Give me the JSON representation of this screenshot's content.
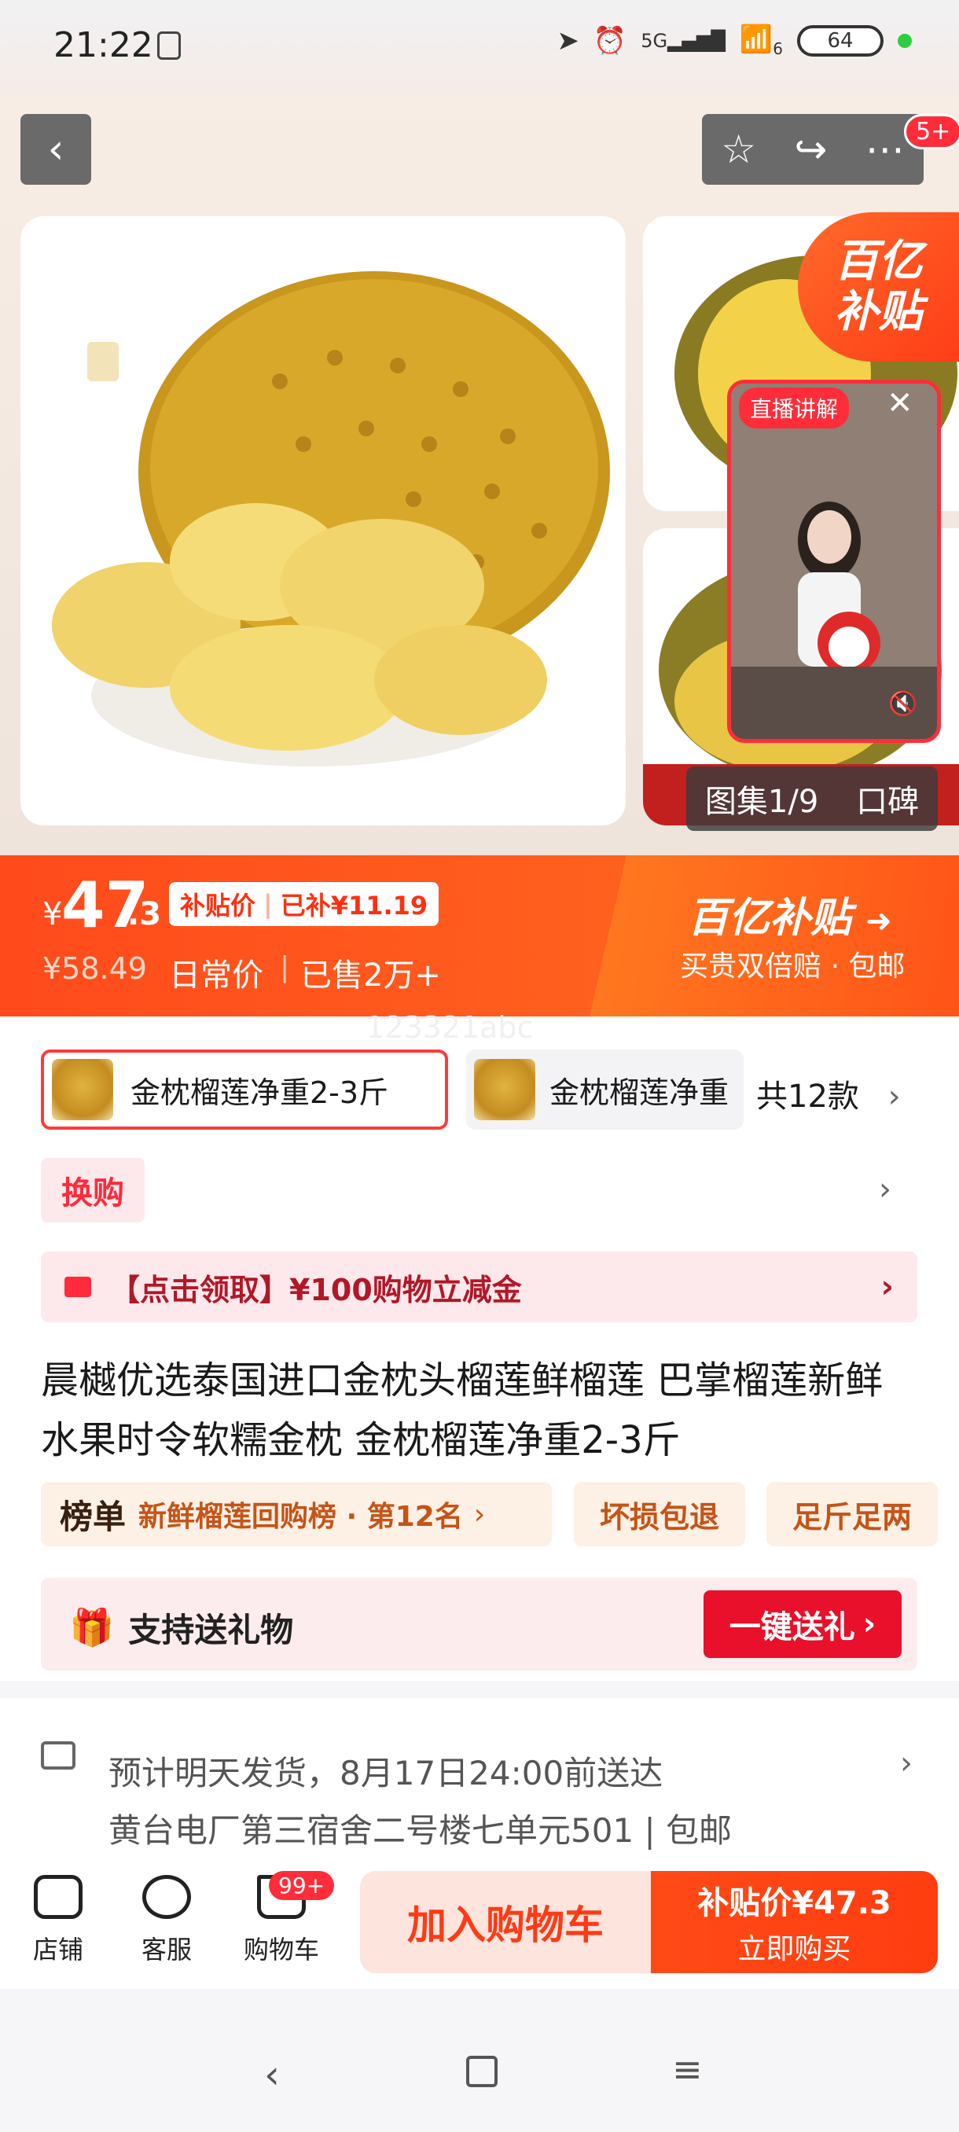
{
  "status_bar": {
    "time": "21:22",
    "signal": "5G",
    "wifi_level": "6",
    "battery": "64"
  },
  "header": {
    "badge": "5+"
  },
  "gallery": {
    "live_tag": "直播讲解",
    "live_close": "✕",
    "count": "图集1/9",
    "alt_tab": "口碑",
    "subsidy_line1": "百亿",
    "subsidy_line2": "补贴"
  },
  "price": {
    "currency": "¥",
    "integer": "47",
    "decimal": ".3",
    "subsidy_label": "补贴价",
    "subsidy_amount": "已补¥11.19",
    "original": "¥58.49",
    "daily_label": "日常价",
    "sold": "已售2万+",
    "brand_title": "百亿补贴",
    "brand_sub": "买贵双倍赔 · 包邮"
  },
  "watermark": "123321abc",
  "sku": {
    "selected": "金枕榴莲净重2-3斤",
    "other": "金枕榴莲净重",
    "count": "共12款"
  },
  "swap": {
    "label": "换购"
  },
  "coupon": {
    "text": "【点击领取】¥100购物立减金"
  },
  "product": {
    "title": "晨樾优选泰国进口金枕头榴莲鲜榴莲 巴掌榴莲新鲜水果时令软糯金枕 金枕榴莲净重2-3斤"
  },
  "rank": {
    "label": "榜单",
    "text": "新鲜榴莲回购榜 · 第12名"
  },
  "tags": [
    "坏损包退",
    "足斤足两"
  ],
  "gift": {
    "label": "支持送礼物",
    "button": "一键送礼"
  },
  "delivery": {
    "line1": "预计明天发货，8月17日24:00前送达",
    "line2": "黄台电厂第三宿舍二号楼七单元501 | 包邮"
  },
  "bottom_nav": {
    "store": "店铺",
    "service": "客服",
    "cart": "购物车",
    "cart_badge": "99+",
    "add_cart": "加入购物车",
    "buy_price": "补贴价¥47.3",
    "buy_label": "立即购买"
  }
}
